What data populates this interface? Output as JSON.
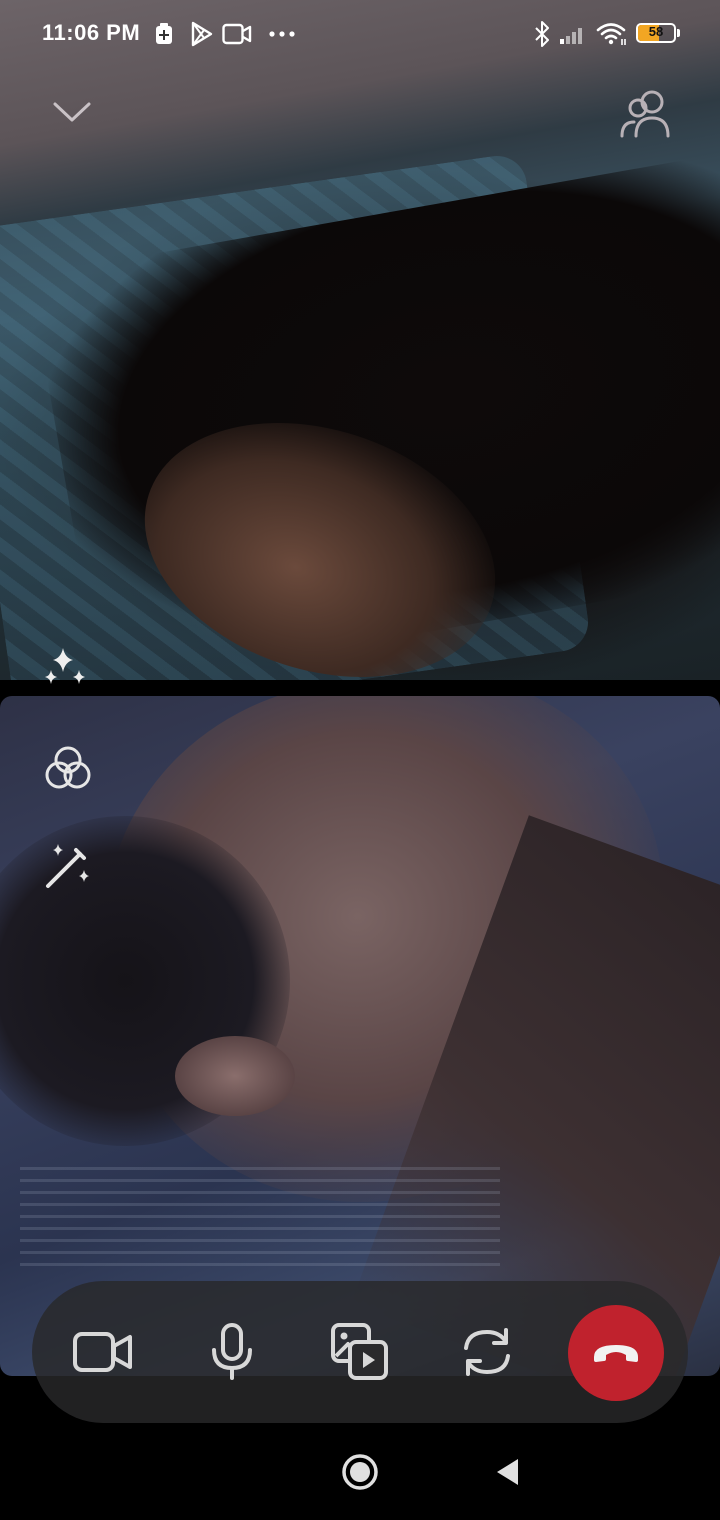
{
  "status_bar": {
    "time": "11:06 PM",
    "battery_level": "58",
    "battery_fraction": 0.58,
    "left_icons": [
      "battery-saver-icon",
      "play-store-icon",
      "video-call-icon",
      "more-dots-icon"
    ],
    "right_icons": [
      "bluetooth-icon",
      "signal-icon",
      "wifi-icon",
      "battery-icon"
    ]
  },
  "call": {
    "remote_video_label": "",
    "local_video_label": ""
  },
  "top_controls": {
    "collapse_icon": "chevron-down-icon",
    "participants_icon": "add-participants-icon"
  },
  "side_controls": {
    "effects_icon": "sparkles-icon",
    "filters_icon": "filters-icon",
    "magic_icon": "magic-wand-icon"
  },
  "controls": [
    {
      "name": "camera-toggle",
      "icon": "video-camera-icon"
    },
    {
      "name": "mic-toggle",
      "icon": "microphone-icon"
    },
    {
      "name": "share-media",
      "icon": "media-share-icon"
    },
    {
      "name": "flip-camera",
      "icon": "flip-camera-icon"
    },
    {
      "name": "end-call",
      "icon": "hang-up-icon"
    }
  ],
  "colors": {
    "end_call": "#c0222d",
    "battery_fill": "#f2a623",
    "control_bar": "#28282a"
  },
  "nav_bar": {
    "home_icon": "home-circle-icon",
    "back_icon": "back-triangle-icon"
  }
}
